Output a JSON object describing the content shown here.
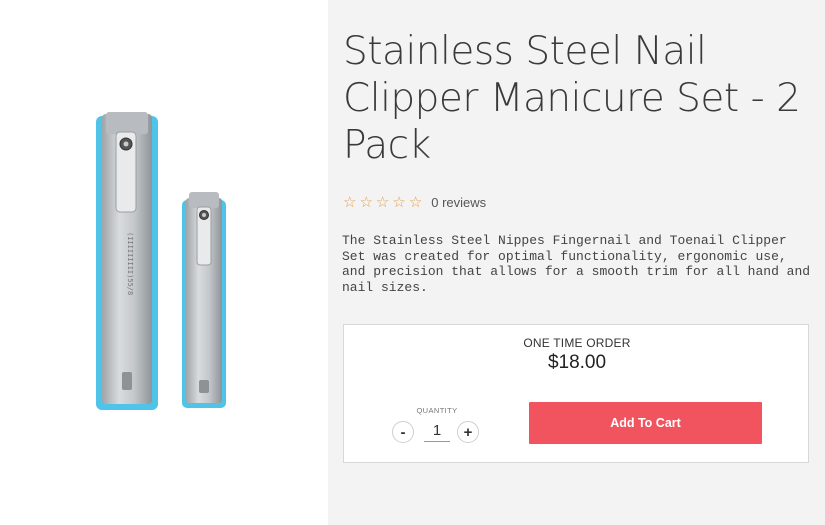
{
  "product": {
    "title": "Stainless Steel Nail Clipper Manicure Set - 2 Pack",
    "image_alt": "product-photo-two-nail-clippers",
    "rating": {
      "stars": 0,
      "max_stars": 5,
      "reviews_text": "0 reviews"
    },
    "description": "The Stainless Steel Nippes Fingernail and Toenail Clipper Set was created for optimal functionality, ergonomic use, and precision that allows for a smooth trim for all hand and nail sizes."
  },
  "purchase": {
    "order_type": "ONE TIME ORDER",
    "price": "$18.00",
    "quantity_label": "QUANTITY",
    "quantity": "1",
    "minus_label": "-",
    "plus_label": "+",
    "add_to_cart_label": "Add To Cart"
  },
  "colors": {
    "accent": "#f2545f",
    "star": "#e0a050",
    "clipper_edge": "#4fc3e8",
    "panel_bg": "#f3f3f3"
  }
}
